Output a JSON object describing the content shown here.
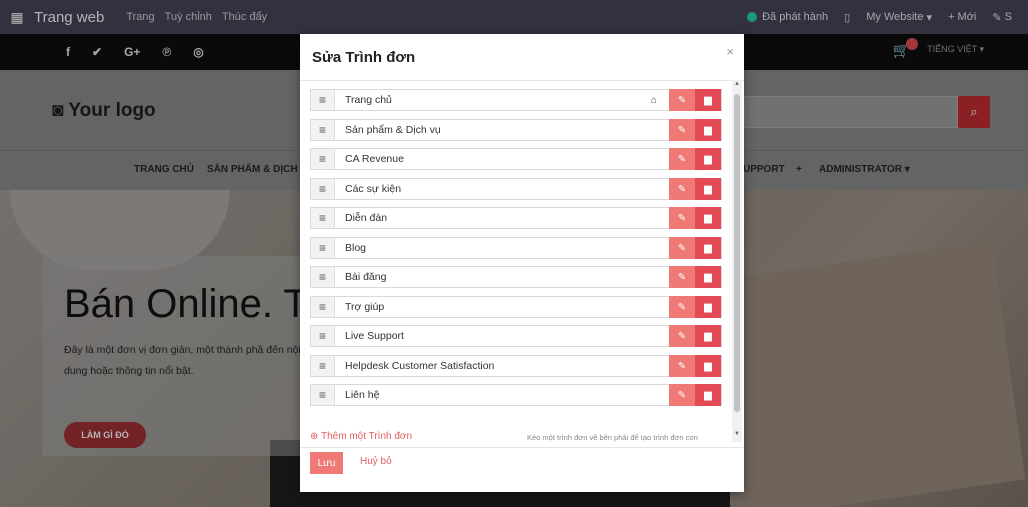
{
  "topbar": {
    "brand": "Trang web",
    "nav": [
      "Trang",
      "Tuỳ chỉnh",
      "Thúc đẩy"
    ],
    "published": "Đã phát hành",
    "website": "My Website",
    "new": "Mới",
    "edit_short": "S"
  },
  "socialbar": {
    "lang": "TIẾNG VIỆT"
  },
  "header": {
    "logo": "Your logo"
  },
  "mainnav": {
    "home": "TRANG CHỦ",
    "products": "SẢN PHẨM & DỊCH V",
    "support": "UPPORT",
    "admin": "ADMINISTRATOR"
  },
  "hero": {
    "title": "Bán Online. T",
    "text": "Đây là một đơn vị đơn giản, một thành phầ đến nội dung hoặc thông tin nổi bật.",
    "button": "LÀM GÌ ĐÓ"
  },
  "modal": {
    "title": "Sửa Trình đơn",
    "close": "×",
    "items": [
      {
        "label": "Trang chủ"
      },
      {
        "label": "Sản phẩm & Dịch vụ"
      },
      {
        "label": "CA Revenue"
      },
      {
        "label": "Các sự kiện"
      },
      {
        "label": "Diễn đàn"
      },
      {
        "label": "Blog"
      },
      {
        "label": "Bài đăng"
      },
      {
        "label": "Trợ giúp"
      },
      {
        "label": "Live Support"
      },
      {
        "label": "Helpdesk Customer Satisfaction"
      },
      {
        "label": "Liên hệ"
      }
    ],
    "add_label": "Thêm một Trình đơn",
    "hint": "Kéo một trình đơn về bên phải để tạo trình đơn con",
    "save": "Lưu",
    "cancel": "Huỷ bỏ"
  }
}
